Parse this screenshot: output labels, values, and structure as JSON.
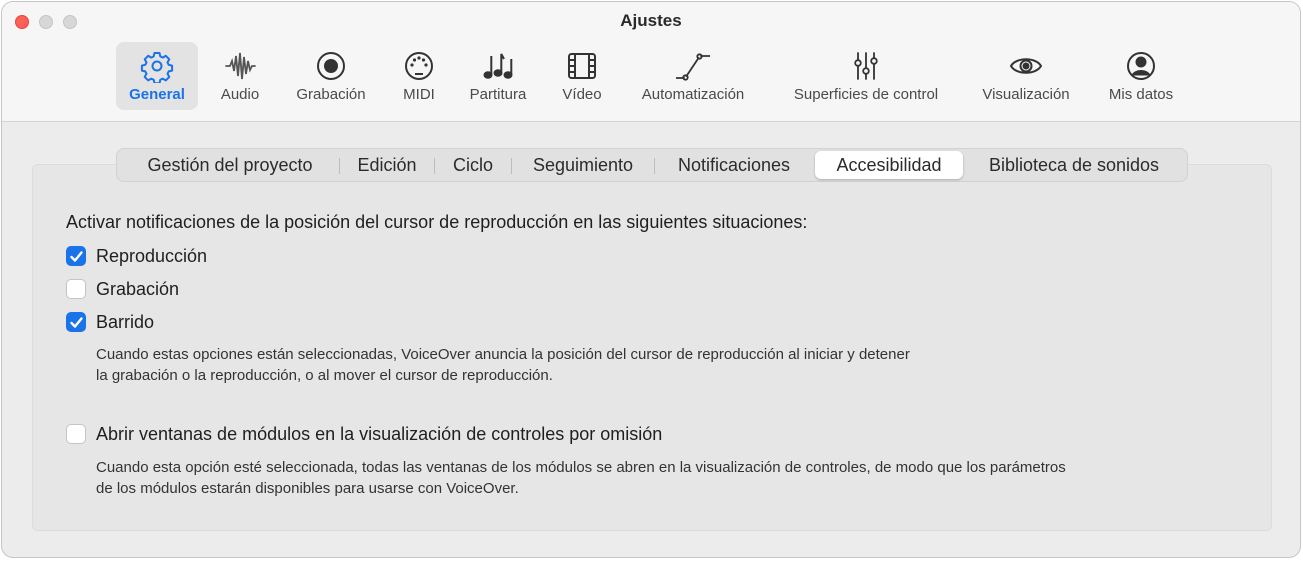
{
  "window": {
    "title": "Ajustes"
  },
  "toolbar": {
    "tabs": [
      {
        "label": "General",
        "icon": "gear-icon",
        "selected": true
      },
      {
        "label": "Audio",
        "icon": "waveform-icon",
        "selected": false
      },
      {
        "label": "Grabación",
        "icon": "record-icon",
        "selected": false
      },
      {
        "label": "MIDI",
        "icon": "midi-port-icon",
        "selected": false
      },
      {
        "label": "Partitura",
        "icon": "music-notes-icon",
        "selected": false
      },
      {
        "label": "Vídeo",
        "icon": "film-icon",
        "selected": false
      },
      {
        "label": "Automatización",
        "icon": "automation-curve-icon",
        "selected": false
      },
      {
        "label": "Superficies de control",
        "icon": "sliders-icon",
        "selected": false
      },
      {
        "label": "Visualización",
        "icon": "eye-icon",
        "selected": false
      },
      {
        "label": "Mis datos",
        "icon": "person-circle-icon",
        "selected": false
      }
    ]
  },
  "subtabs": {
    "items": [
      {
        "label": "Gestión del proyecto",
        "selected": false
      },
      {
        "label": "Edición",
        "selected": false
      },
      {
        "label": "Ciclo",
        "selected": false
      },
      {
        "label": "Seguimiento",
        "selected": false
      },
      {
        "label": "Notificaciones",
        "selected": false
      },
      {
        "label": "Accesibilidad",
        "selected": true
      },
      {
        "label": "Biblioteca de sonidos",
        "selected": false
      }
    ]
  },
  "accessibility": {
    "intro": "Activar notificaciones de la posición del cursor de reproducción en las siguientes situaciones:",
    "options": [
      {
        "label": "Reproducción",
        "checked": true
      },
      {
        "label": "Grabación",
        "checked": false
      },
      {
        "label": "Barrido",
        "checked": true
      }
    ],
    "options_desc_line1": "Cuando estas opciones están seleccionadas, VoiceOver anuncia la posición del cursor de reproducción al iniciar y detener",
    "options_desc_line2": "la grabación o la reproducción, o al mover el cursor de reproducción.",
    "plugin_option": {
      "label": "Abrir ventanas de módulos en la visualización de controles por omisión",
      "checked": false
    },
    "plugin_desc_line1": "Cuando esta opción esté seleccionada, todas las ventanas de los módulos se abren en la visualización de controles, de modo que los parámetros",
    "plugin_desc_line2": "de los módulos estarán disponibles para usarse con VoiceOver."
  },
  "colors": {
    "accent": "#1a73e8",
    "close_button": "#fe5f57"
  }
}
